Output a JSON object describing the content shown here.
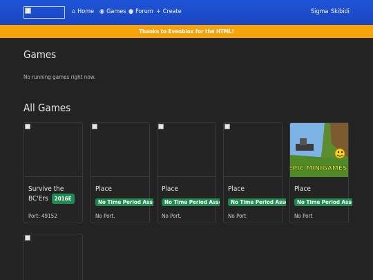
{
  "nav": {
    "home": "Home",
    "games": "Games",
    "forum": "Forum",
    "create": "Create",
    "user": "Sigma",
    "extra": "Skibidi"
  },
  "banner": "Thanks to Evenblox for the HTML!",
  "running": {
    "title": "Games",
    "empty": "No running games right now."
  },
  "all_games": {
    "title": "All Games",
    "cards": [
      {
        "name": "Survive the BC'Ers",
        "badge": "2016E",
        "port": "Port: 49152"
      },
      {
        "name": "Place",
        "badge": "No Time Period Asserted",
        "port": "No Port."
      },
      {
        "name": "Place",
        "badge": "No Time Period Asserted",
        "port": "No Port."
      },
      {
        "name": "Place",
        "badge": "No Time Period Asserted",
        "port": "No Port"
      },
      {
        "name": "Place",
        "badge": "No Time Period Asserted",
        "port": "No Port",
        "thumb_text": "EPIC MINIGAMES"
      }
    ]
  },
  "colors": {
    "navbar": "#1a45c0",
    "banner": "#f5a20b",
    "badge": "#1e8a50",
    "background": "#232323"
  }
}
